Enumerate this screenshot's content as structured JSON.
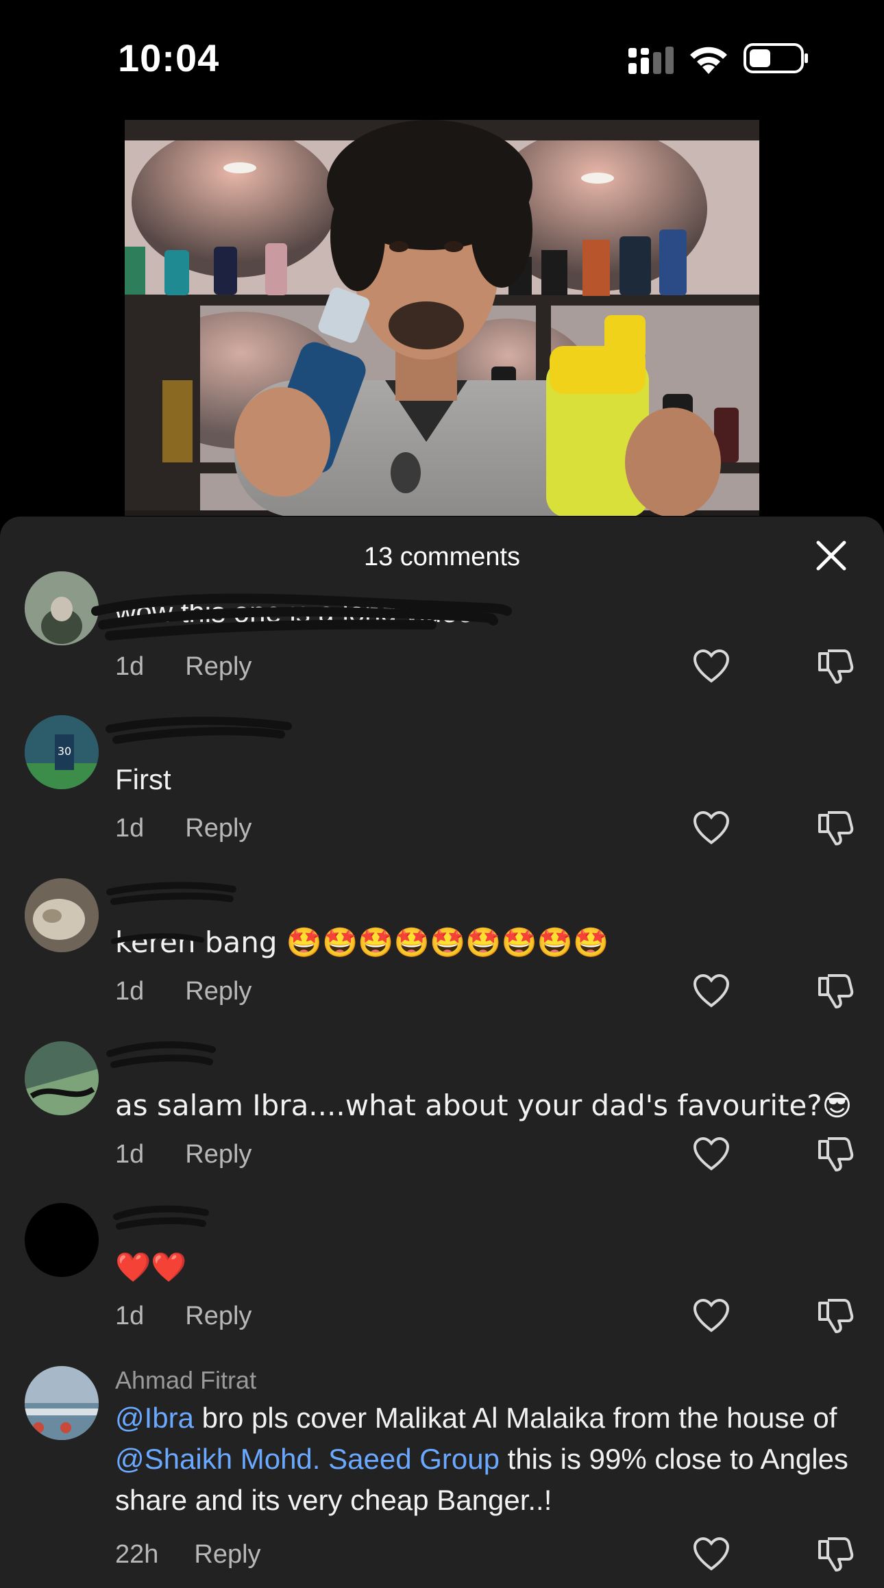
{
  "status_bar": {
    "time": "10:04"
  },
  "sheet": {
    "title": "13 comments"
  },
  "comments": [
    {
      "username": "",
      "text": "wow this one is a long video",
      "age": "1d",
      "reply_label": "Reply"
    },
    {
      "username": "",
      "text": "First",
      "age": "1d",
      "reply_label": "Reply"
    },
    {
      "username": "",
      "text": "keren bang 🤩🤩🤩🤩🤩🤩🤩🤩🤩",
      "age": "1d",
      "reply_label": "Reply"
    },
    {
      "username": "",
      "text": "as salam Ibra....what about your dad's favourite?😎",
      "age": "1d",
      "reply_label": "Reply"
    },
    {
      "username": "",
      "text": "❤️❤️",
      "age": "1d",
      "reply_label": "Reply"
    },
    {
      "username": "Ahmad Fitrat",
      "mention_1": "@Ibra",
      "text_1": " bro pls cover Malikat Al Malaika from the house of ",
      "mention_2": "@Shaikh Mohd. Saeed Group",
      "text_2": " this is 99% close to Angles share and its very cheap Banger..!",
      "age": "22h",
      "reply_label": "Reply"
    }
  ]
}
